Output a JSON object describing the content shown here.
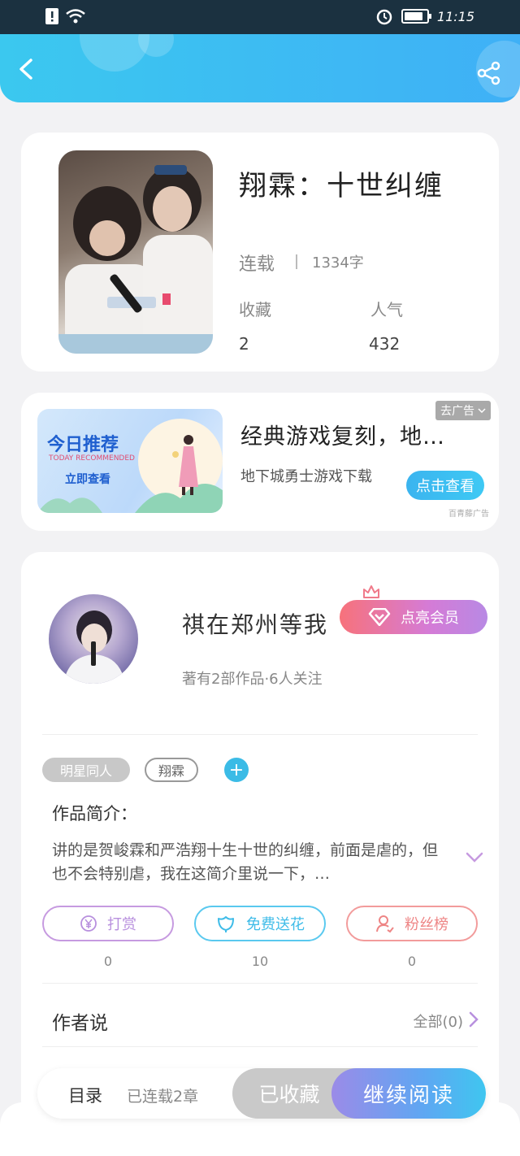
{
  "status_bar": {
    "time": "11:15"
  },
  "book": {
    "title": "翔霖：十世纠缠",
    "status": "连载",
    "word_count": "1334字",
    "stats": [
      {
        "label": "收藏",
        "value": "2"
      },
      {
        "label": "人气",
        "value": "432"
      }
    ]
  },
  "ad": {
    "banner_title": "今日推荐",
    "banner_subtitle": "TODAY RECOMMENDED",
    "banner_cta": "立即查看",
    "title": "经典游戏复刻，地…",
    "description": "地下城勇士游戏下载",
    "close_label": "去广告",
    "button_label": "点击查看",
    "source": "百青藤广告"
  },
  "author": {
    "name": "祺在郑州等我",
    "vip_label": "点亮会员",
    "meta": "著有2部作品·6人关注",
    "tags": [
      "明星同人",
      "翔霖"
    ],
    "intro_label": "作品简介：",
    "intro_text": "讲的是贺峻霖和严浩翔十生十世的纠缠，前面是虐的，但也不会特别虐，我在这简介里说一下，…",
    "actions": [
      {
        "label": "打赏",
        "count": "0"
      },
      {
        "label": "免费送花",
        "count": "10"
      },
      {
        "label": "粉丝榜",
        "count": "0"
      }
    ],
    "author_says_label": "作者说",
    "author_says_all": "全部(0)"
  },
  "bottom": {
    "toc_label": "目录",
    "chapters": "已连载2章",
    "favorited": "已收藏",
    "continue": "继续阅读"
  },
  "colors": {
    "header_gradient_start": "#3bc8ef",
    "header_gradient_end": "#3fb0f6",
    "accent_blue": "#3bbbe6",
    "vip_pink": "#f7727b",
    "vip_purple": "#b889e4"
  },
  "icons": [
    "back-icon",
    "share-icon",
    "wifi-icon",
    "alert-icon",
    "alarm-icon",
    "battery-icon",
    "vip-crown-icon",
    "diamond-icon",
    "yen-icon",
    "flower-icon",
    "user-icon",
    "chevron-down-icon",
    "chevron-right-icon",
    "plus-icon"
  ]
}
